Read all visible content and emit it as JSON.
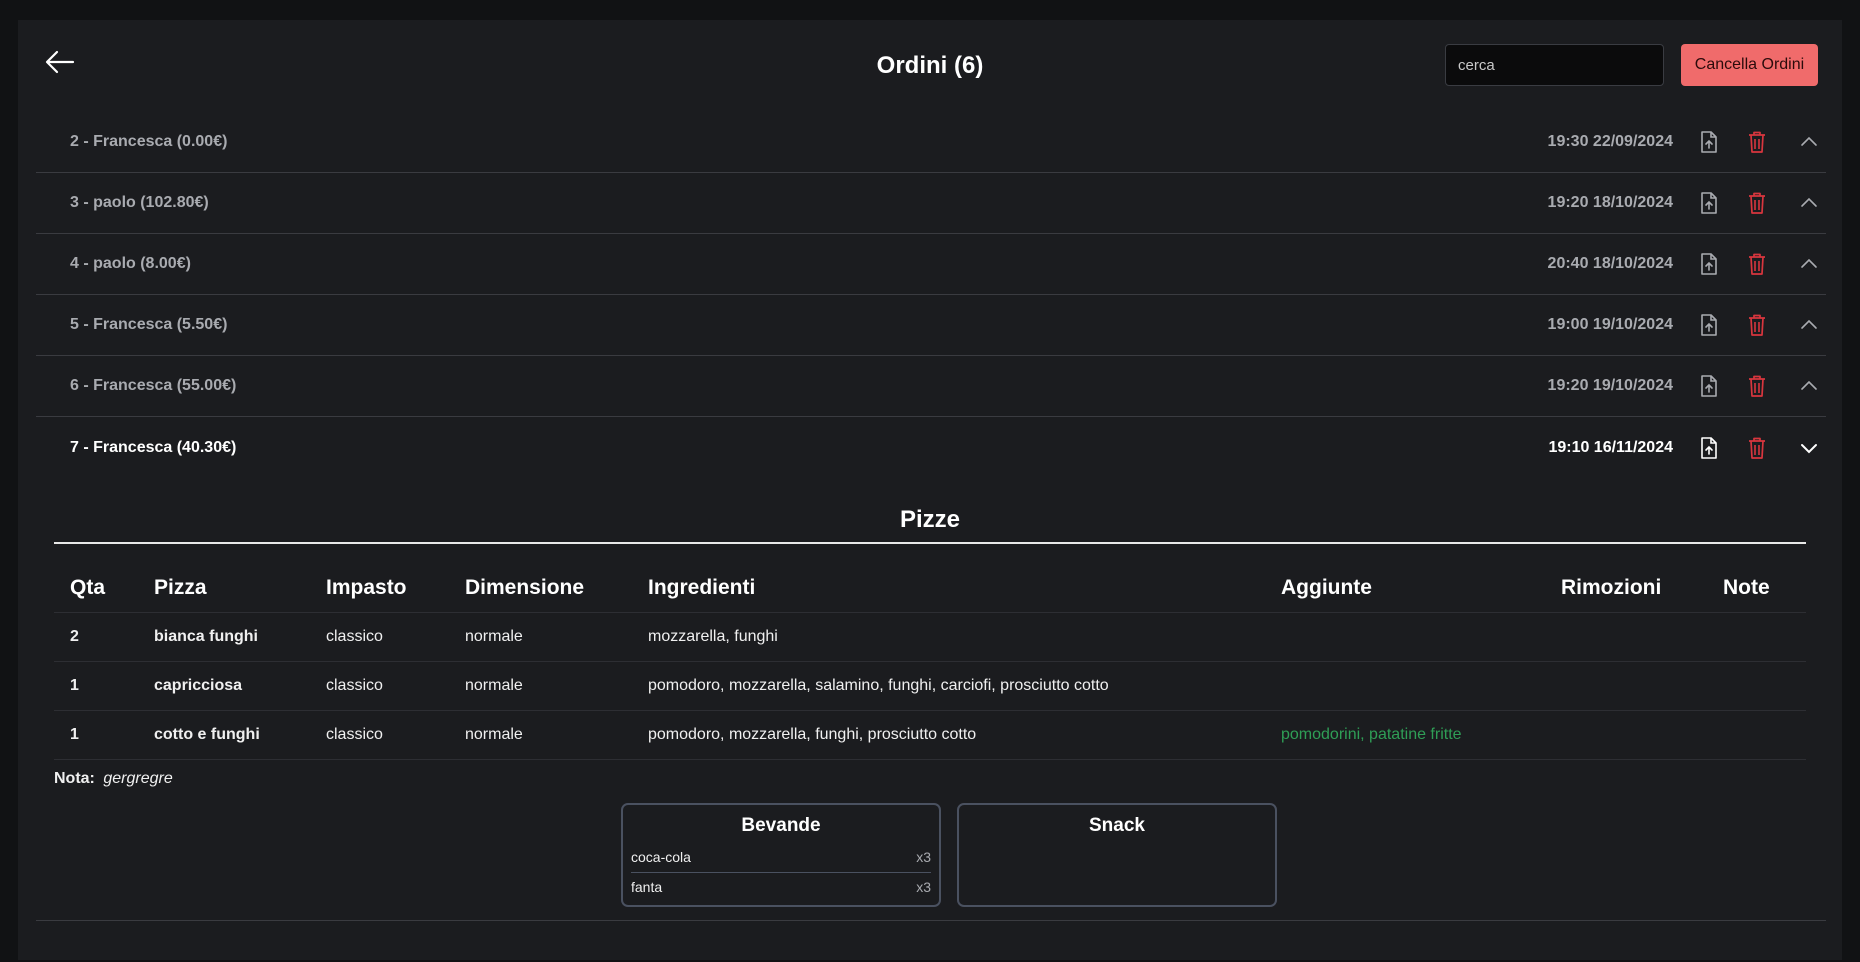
{
  "header": {
    "title": "Ordini (6)",
    "search_placeholder": "cerca",
    "search_value": "",
    "cancel_label": "Cancella Ordini"
  },
  "orders": [
    {
      "label": "2 - Francesca (0.00€)",
      "datetime": "19:30 22/09/2024",
      "expanded": false
    },
    {
      "label": "3 - paolo (102.80€)",
      "datetime": "19:20 18/10/2024",
      "expanded": false
    },
    {
      "label": "4 - paolo (8.00€)",
      "datetime": "20:40 18/10/2024",
      "expanded": false
    },
    {
      "label": "5 - Francesca (5.50€)",
      "datetime": "19:00 19/10/2024",
      "expanded": false
    },
    {
      "label": "6 - Francesca (55.00€)",
      "datetime": "19:20 19/10/2024",
      "expanded": false
    },
    {
      "label": "7 - Francesca (40.30€)",
      "datetime": "19:10 16/11/2024",
      "expanded": true
    }
  ],
  "detail": {
    "section_title": "Pizze",
    "columns": [
      "Qta",
      "Pizza",
      "Impasto",
      "Dimensione",
      "Ingredienti",
      "Aggiunte",
      "Rimozioni",
      "Note"
    ],
    "rows": [
      {
        "qta": "2",
        "pizza": "bianca funghi",
        "impasto": "classico",
        "dimensione": "normale",
        "ingredienti": "mozzarella, funghi",
        "aggiunte": "",
        "rimozioni": "",
        "note": ""
      },
      {
        "qta": "1",
        "pizza": "capricciosa",
        "impasto": "classico",
        "dimensione": "normale",
        "ingredienti": "pomodoro, mozzarella, salamino, funghi, carciofi, prosciutto cotto",
        "aggiunte": "",
        "rimozioni": "",
        "note": ""
      },
      {
        "qta": "1",
        "pizza": "cotto e funghi",
        "impasto": "classico",
        "dimensione": "normale",
        "ingredienti": "pomodoro, mozzarella, funghi, prosciutto cotto",
        "aggiunte": "pomodorini, patatine fritte",
        "rimozioni": "",
        "note": ""
      }
    ],
    "note_label": "Nota:",
    "note_value": "gergregre",
    "drinks": {
      "title": "Bevande",
      "items": [
        {
          "name": "coca-cola",
          "qty": "x3"
        },
        {
          "name": "fanta",
          "qty": "x3"
        }
      ]
    },
    "snacks": {
      "title": "Snack",
      "items": []
    }
  },
  "colors": {
    "background": "#1b1c1f",
    "accent_red": "#f06b6b",
    "delete_icon": "#d9363e",
    "additions_green": "#2f9e56"
  }
}
